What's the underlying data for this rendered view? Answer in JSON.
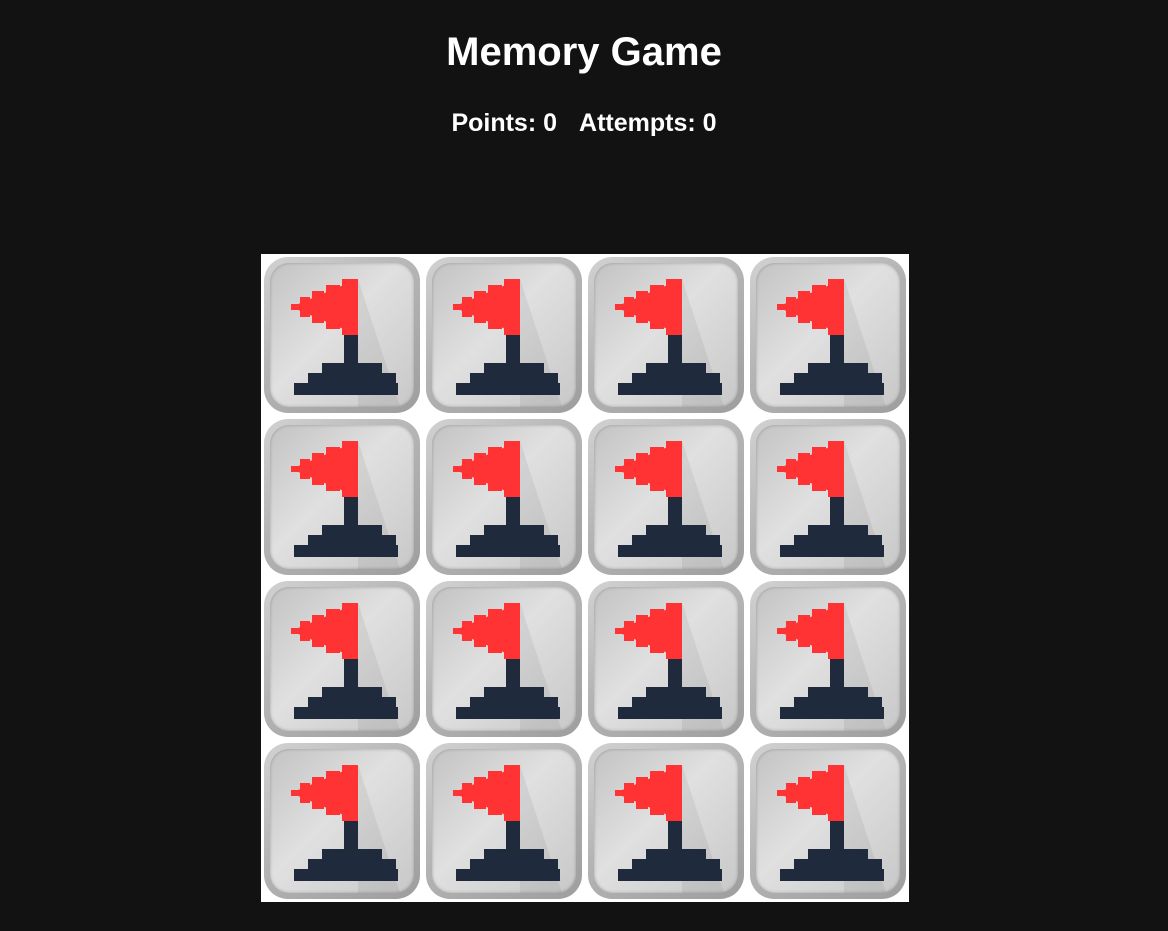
{
  "header": {
    "title": "Memory Game"
  },
  "stats": {
    "points_label": "Points:",
    "points_value": "0",
    "attempts_label": "Attempts:",
    "attempts_value": "0"
  },
  "board": {
    "rows": 4,
    "columns": 4,
    "card_back_icon": "flag-icon",
    "cards": [
      {
        "state": "face-down"
      },
      {
        "state": "face-down"
      },
      {
        "state": "face-down"
      },
      {
        "state": "face-down"
      },
      {
        "state": "face-down"
      },
      {
        "state": "face-down"
      },
      {
        "state": "face-down"
      },
      {
        "state": "face-down"
      },
      {
        "state": "face-down"
      },
      {
        "state": "face-down"
      },
      {
        "state": "face-down"
      },
      {
        "state": "face-down"
      },
      {
        "state": "face-down"
      },
      {
        "state": "face-down"
      },
      {
        "state": "face-down"
      },
      {
        "state": "face-down"
      }
    ]
  },
  "colors": {
    "background": "#121212",
    "flag": "#ff3333",
    "pole": "#1f2a3c",
    "board": "#ffffff"
  }
}
